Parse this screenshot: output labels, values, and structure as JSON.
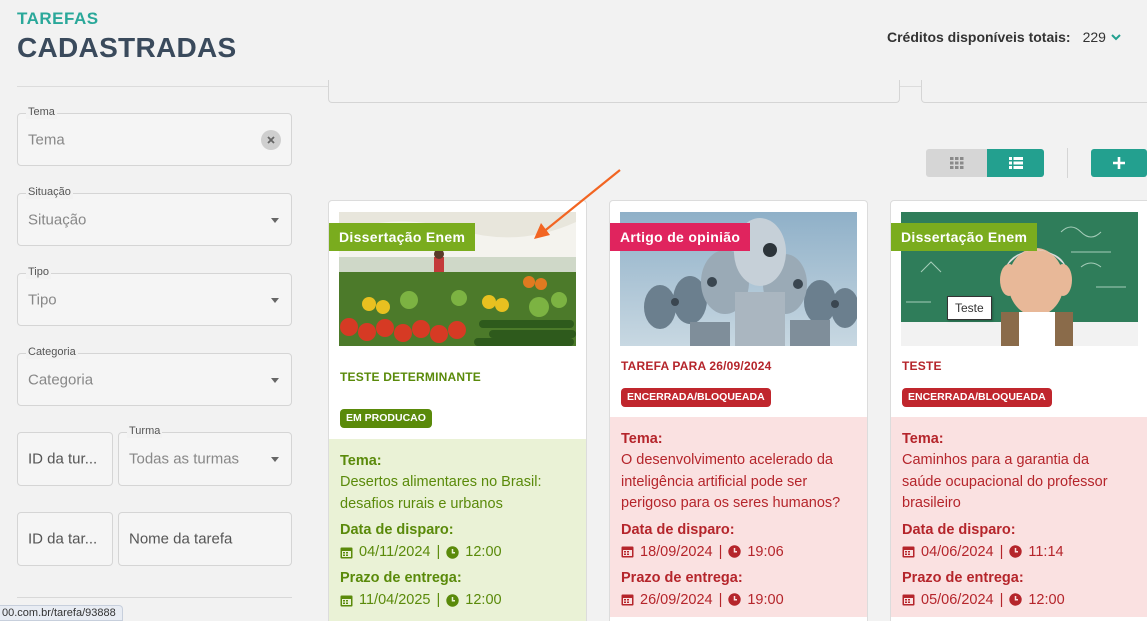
{
  "header": {
    "small_title": "TAREFAS",
    "big_title": "CADASTRADAS",
    "credits_label": "Créditos disponíveis totais:",
    "credits_value": "229"
  },
  "filters": {
    "tema": {
      "label": "Tema",
      "placeholder": "Tema"
    },
    "situacao": {
      "label": "Situação",
      "placeholder": "Situação"
    },
    "tipo": {
      "label": "Tipo",
      "placeholder": "Tipo"
    },
    "categoria": {
      "label": "Categoria",
      "placeholder": "Categoria"
    },
    "id_turma": {
      "placeholder": "ID da tur..."
    },
    "turma": {
      "label": "Turma",
      "placeholder": "Todas as turmas"
    },
    "id_tarefa": {
      "placeholder": "ID da tar..."
    },
    "nome_tarefa": {
      "placeholder": "Nome da tarefa"
    }
  },
  "status_url": "00.com.br/tarefa/93888",
  "cards": [
    {
      "ribbon": "Dissertação Enem",
      "ribbon_color": "#7aac1e",
      "title": "TESTE DETERMINANTE",
      "status": "EM PRODUCAO",
      "status_color": "#5a8a0a",
      "tema_label": "Tema:",
      "tema": "Desertos alimentares no Brasil: desafios rurais e urbanos",
      "tema_lines": [
        "Desertos alimentares no Brasil:",
        "desafios rurais e urbanos"
      ],
      "disparo_label": "Data de disparo:",
      "disparo_date": "04/11/2024",
      "disparo_time": "12:00",
      "prazo_label": "Prazo de entrega:",
      "prazo_date": "11/04/2025",
      "prazo_time": "12:00"
    },
    {
      "ribbon": "Artigo de opinião",
      "ribbon_color": "#e0245e",
      "title": "TAREFA PARA 26/09/2024",
      "status": "ENCERRADA/BLOQUEADA",
      "status_color": "#c0262d",
      "tema_label": "Tema:",
      "tema_lines": [
        "O desenvolvimento acelerado da",
        "inteligência artificial pode ser",
        "perigoso para os seres humanos?"
      ],
      "disparo_label": "Data de disparo:",
      "disparo_date": "18/09/2024",
      "disparo_time": "19:06",
      "prazo_label": "Prazo de entrega:",
      "prazo_date": "26/09/2024",
      "prazo_time": "19:00"
    },
    {
      "ribbon": "Dissertação Enem",
      "ribbon_color": "#7aac1e",
      "title": "TESTE",
      "status": "ENCERRADA/BLOQUEADA",
      "status_color": "#c0262d",
      "tema_label": "Tema:",
      "tema_lines": [
        "Caminhos para a garantia da",
        "saúde ocupacional do professor",
        "brasileiro"
      ],
      "disparo_label": "Data de disparo:",
      "disparo_date": "04/06/2024",
      "disparo_time": "11:14",
      "prazo_label": "Prazo de entrega:",
      "prazo_date": "05/06/2024",
      "prazo_time": "12:00"
    }
  ],
  "tooltip": "Teste",
  "colors": {
    "accent": "#23a08f",
    "title": "#3a4a5c",
    "arrow": "#f26522"
  }
}
